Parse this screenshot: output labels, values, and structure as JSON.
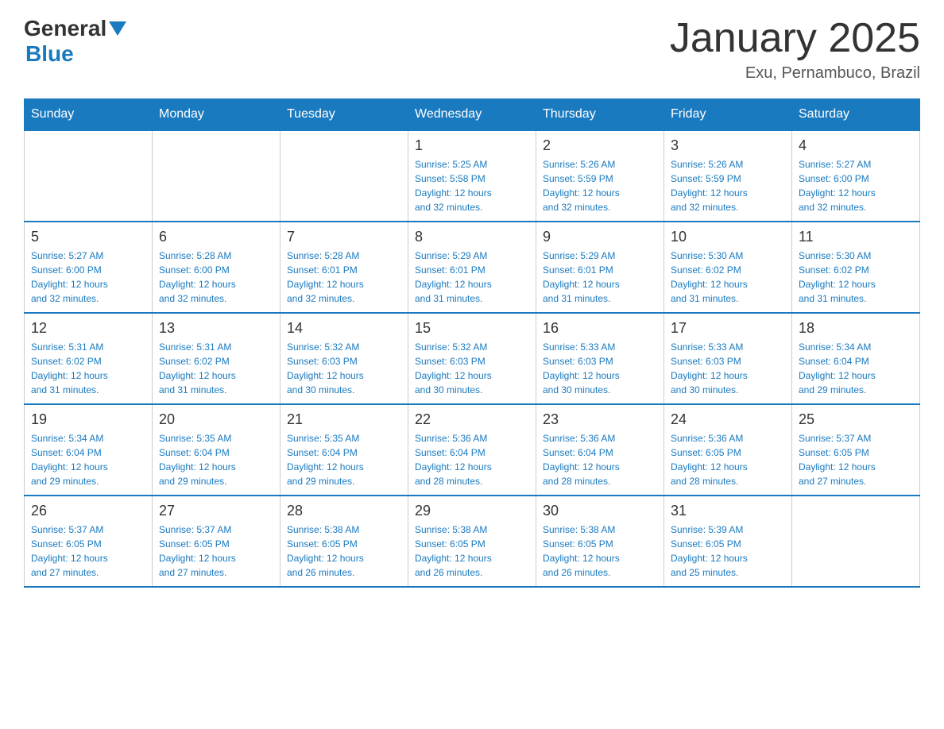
{
  "logo": {
    "general": "General",
    "blue": "Blue"
  },
  "title": "January 2025",
  "location": "Exu, Pernambuco, Brazil",
  "days_of_week": [
    "Sunday",
    "Monday",
    "Tuesday",
    "Wednesday",
    "Thursday",
    "Friday",
    "Saturday"
  ],
  "weeks": [
    [
      {
        "day": "",
        "info": ""
      },
      {
        "day": "",
        "info": ""
      },
      {
        "day": "",
        "info": ""
      },
      {
        "day": "1",
        "info": "Sunrise: 5:25 AM\nSunset: 5:58 PM\nDaylight: 12 hours\nand 32 minutes."
      },
      {
        "day": "2",
        "info": "Sunrise: 5:26 AM\nSunset: 5:59 PM\nDaylight: 12 hours\nand 32 minutes."
      },
      {
        "day": "3",
        "info": "Sunrise: 5:26 AM\nSunset: 5:59 PM\nDaylight: 12 hours\nand 32 minutes."
      },
      {
        "day": "4",
        "info": "Sunrise: 5:27 AM\nSunset: 6:00 PM\nDaylight: 12 hours\nand 32 minutes."
      }
    ],
    [
      {
        "day": "5",
        "info": "Sunrise: 5:27 AM\nSunset: 6:00 PM\nDaylight: 12 hours\nand 32 minutes."
      },
      {
        "day": "6",
        "info": "Sunrise: 5:28 AM\nSunset: 6:00 PM\nDaylight: 12 hours\nand 32 minutes."
      },
      {
        "day": "7",
        "info": "Sunrise: 5:28 AM\nSunset: 6:01 PM\nDaylight: 12 hours\nand 32 minutes."
      },
      {
        "day": "8",
        "info": "Sunrise: 5:29 AM\nSunset: 6:01 PM\nDaylight: 12 hours\nand 31 minutes."
      },
      {
        "day": "9",
        "info": "Sunrise: 5:29 AM\nSunset: 6:01 PM\nDaylight: 12 hours\nand 31 minutes."
      },
      {
        "day": "10",
        "info": "Sunrise: 5:30 AM\nSunset: 6:02 PM\nDaylight: 12 hours\nand 31 minutes."
      },
      {
        "day": "11",
        "info": "Sunrise: 5:30 AM\nSunset: 6:02 PM\nDaylight: 12 hours\nand 31 minutes."
      }
    ],
    [
      {
        "day": "12",
        "info": "Sunrise: 5:31 AM\nSunset: 6:02 PM\nDaylight: 12 hours\nand 31 minutes."
      },
      {
        "day": "13",
        "info": "Sunrise: 5:31 AM\nSunset: 6:02 PM\nDaylight: 12 hours\nand 31 minutes."
      },
      {
        "day": "14",
        "info": "Sunrise: 5:32 AM\nSunset: 6:03 PM\nDaylight: 12 hours\nand 30 minutes."
      },
      {
        "day": "15",
        "info": "Sunrise: 5:32 AM\nSunset: 6:03 PM\nDaylight: 12 hours\nand 30 minutes."
      },
      {
        "day": "16",
        "info": "Sunrise: 5:33 AM\nSunset: 6:03 PM\nDaylight: 12 hours\nand 30 minutes."
      },
      {
        "day": "17",
        "info": "Sunrise: 5:33 AM\nSunset: 6:03 PM\nDaylight: 12 hours\nand 30 minutes."
      },
      {
        "day": "18",
        "info": "Sunrise: 5:34 AM\nSunset: 6:04 PM\nDaylight: 12 hours\nand 29 minutes."
      }
    ],
    [
      {
        "day": "19",
        "info": "Sunrise: 5:34 AM\nSunset: 6:04 PM\nDaylight: 12 hours\nand 29 minutes."
      },
      {
        "day": "20",
        "info": "Sunrise: 5:35 AM\nSunset: 6:04 PM\nDaylight: 12 hours\nand 29 minutes."
      },
      {
        "day": "21",
        "info": "Sunrise: 5:35 AM\nSunset: 6:04 PM\nDaylight: 12 hours\nand 29 minutes."
      },
      {
        "day": "22",
        "info": "Sunrise: 5:36 AM\nSunset: 6:04 PM\nDaylight: 12 hours\nand 28 minutes."
      },
      {
        "day": "23",
        "info": "Sunrise: 5:36 AM\nSunset: 6:04 PM\nDaylight: 12 hours\nand 28 minutes."
      },
      {
        "day": "24",
        "info": "Sunrise: 5:36 AM\nSunset: 6:05 PM\nDaylight: 12 hours\nand 28 minutes."
      },
      {
        "day": "25",
        "info": "Sunrise: 5:37 AM\nSunset: 6:05 PM\nDaylight: 12 hours\nand 27 minutes."
      }
    ],
    [
      {
        "day": "26",
        "info": "Sunrise: 5:37 AM\nSunset: 6:05 PM\nDaylight: 12 hours\nand 27 minutes."
      },
      {
        "day": "27",
        "info": "Sunrise: 5:37 AM\nSunset: 6:05 PM\nDaylight: 12 hours\nand 27 minutes."
      },
      {
        "day": "28",
        "info": "Sunrise: 5:38 AM\nSunset: 6:05 PM\nDaylight: 12 hours\nand 26 minutes."
      },
      {
        "day": "29",
        "info": "Sunrise: 5:38 AM\nSunset: 6:05 PM\nDaylight: 12 hours\nand 26 minutes."
      },
      {
        "day": "30",
        "info": "Sunrise: 5:38 AM\nSunset: 6:05 PM\nDaylight: 12 hours\nand 26 minutes."
      },
      {
        "day": "31",
        "info": "Sunrise: 5:39 AM\nSunset: 6:05 PM\nDaylight: 12 hours\nand 25 minutes."
      },
      {
        "day": "",
        "info": ""
      }
    ]
  ],
  "accent_color": "#1a7abf"
}
